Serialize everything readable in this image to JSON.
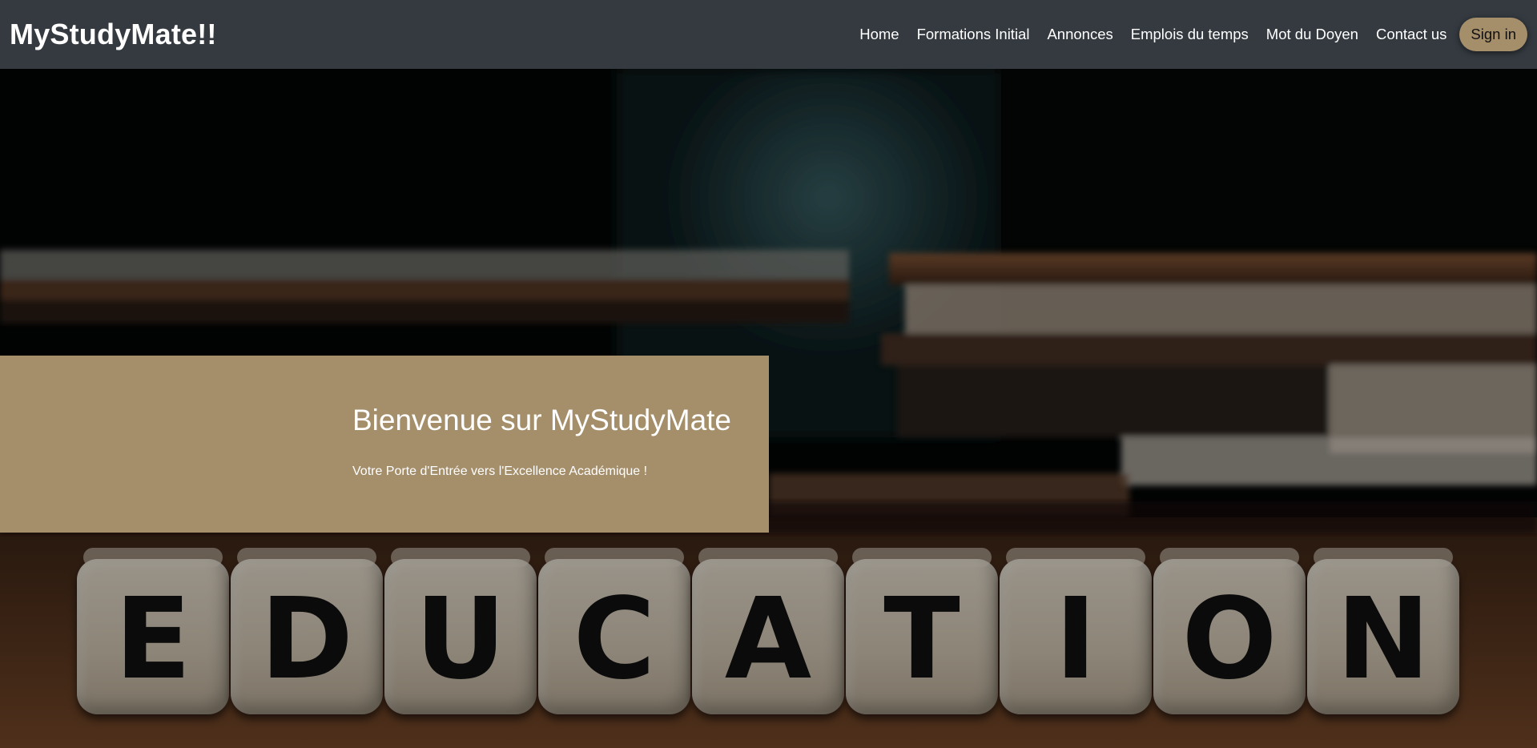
{
  "navbar": {
    "brand": "MyStudyMate!!",
    "links": [
      "Home",
      "Formations Initial",
      "Annonces",
      "Emplois du temps",
      "Mot du Doyen",
      "Contact us"
    ],
    "signin": "Sign in",
    "bg_color": "#343a40"
  },
  "hero": {
    "title": "Bienvenue sur MyStudyMate",
    "subtitle": "Votre Porte d'Entrée vers l'Excellence Académique !",
    "box_color": "#a58e6a",
    "dice_letters": [
      "E",
      "D",
      "U",
      "C",
      "A",
      "T",
      "I",
      "O",
      "N"
    ]
  }
}
